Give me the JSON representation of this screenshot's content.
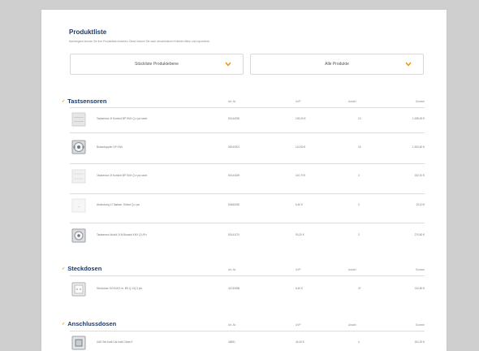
{
  "header": {
    "title": "Produktliste",
    "subtitle": "Nachfolgend können Sie Ihre Produktliste einsehen. Diese können Sie nach verschiedenen Kriterien filtern und exportieren."
  },
  "filters": {
    "level": "Stückliste Produktebene",
    "scope": "Alle Produkte"
  },
  "columns": {
    "artnr": "Art.-Nr.",
    "uvp": "UVP",
    "anzahl": "Anzahl",
    "summe": "Summe"
  },
  "sections": [
    {
      "title": "Tastsensoren",
      "rows": [
        {
          "icon": "switch-white-icon",
          "name": "Tastsensor 4f Komfort BP KNX Q.x pw samt",
          "artnr": "50144030",
          "uvp": "126,00 €",
          "anzahl": "13",
          "summe": "1.638,00 €"
        },
        {
          "icon": "bus-coupler-icon",
          "name": "Busankoppler UP KNX",
          "artnr": "50040001",
          "uvp": "114,60 €",
          "anzahl": "16",
          "summe": "1.833,60 €"
        },
        {
          "icon": "switch-light-icon",
          "name": "Tastsensor 3f Komfort BP KNX Q.x pw samt",
          "artnr": "50144029",
          "uvp": "110,70 €",
          "anzahl": "3",
          "summe": "332,10 €"
        },
        {
          "icon": "cover-plate-icon",
          "name": "Abdeckung 1f Tastsen. Einbut Q.x pw",
          "artnr": "50460030",
          "uvp": "6,40 €",
          "anzahl": "3",
          "summe": "19,20 €"
        },
        {
          "icon": "module-icon",
          "name": "Tastsensor-Modul 1f M.Busank KNX Q.UP.x",
          "artnr": "50141170",
          "uvp": "90,20 €",
          "anzahl": "3",
          "summe": "270,60 €"
        }
      ]
    },
    {
      "title": "Steckdosen",
      "rows": [
        {
          "icon": "socket-icon",
          "name": "Steckdose SCHUKO m. BS Q.1/Q.3 pw",
          "artnr": "41230058",
          "uvp": "8,40 €",
          "anzahl": "37",
          "summe": "310,80 €"
        }
      ]
    },
    {
      "title": "Anschlussdosen",
      "rows": [
        {
          "icon": "data-socket-icon",
          "name": "UAE Bel.Kat6 Cat Kat6 Class E",
          "artnr": "45851",
          "uvp": "40,30 €",
          "anzahl": "4",
          "summe": "161,20 €"
        }
      ]
    }
  ],
  "colors": {
    "heading": "#1a3a6b",
    "accent": "#f29200"
  }
}
